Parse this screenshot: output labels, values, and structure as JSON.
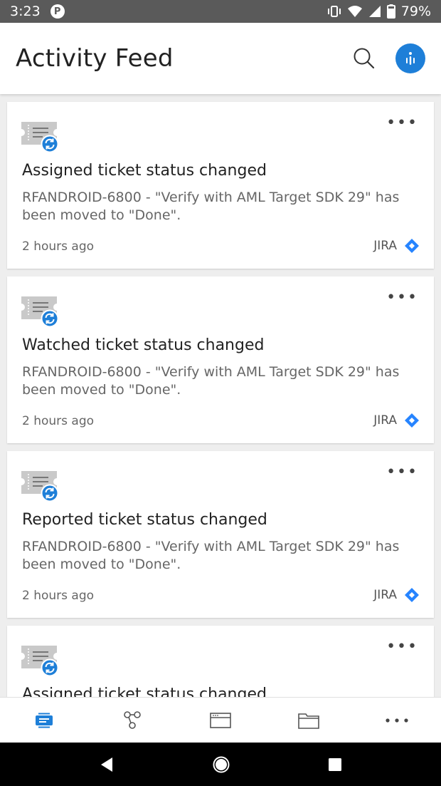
{
  "status_bar": {
    "time": "3:23",
    "battery": "79%"
  },
  "header": {
    "title": "Activity Feed"
  },
  "feed": [
    {
      "title": "Assigned ticket status changed",
      "description": "RFANDROID-6800 - \"Verify with AML Target SDK 29\" has been moved to \"Done\".",
      "time": "2 hours ago",
      "source": "JIRA"
    },
    {
      "title": "Watched ticket status changed",
      "description": "RFANDROID-6800 - \"Verify with AML Target SDK 29\" has been moved to \"Done\".",
      "time": "2 hours ago",
      "source": "JIRA"
    },
    {
      "title": "Reported ticket status changed",
      "description": "RFANDROID-6800 - \"Verify with AML Target SDK 29\" has been moved to \"Done\".",
      "time": "2 hours ago",
      "source": "JIRA"
    },
    {
      "title": "Assigned ticket status changed",
      "description": "",
      "time": "",
      "source": ""
    }
  ],
  "icons": {
    "status": [
      "p-badge-icon",
      "vibrate-icon",
      "wifi-icon",
      "signal-icon",
      "battery-icon"
    ],
    "header": [
      "search-icon",
      "profile-icon"
    ],
    "card": [
      "ticket-status-icon",
      "more-options-icon",
      "jira-logo-icon"
    ],
    "bottom_nav": [
      "activity-feed-icon",
      "graph-icon",
      "browser-icon",
      "folder-icon",
      "more-icon"
    ],
    "system_nav": [
      "back-icon",
      "home-icon",
      "recents-icon"
    ]
  },
  "colors": {
    "accent": "#1e7fd8",
    "status_bar": "#5a5a5a",
    "jira": "#2684ff"
  }
}
